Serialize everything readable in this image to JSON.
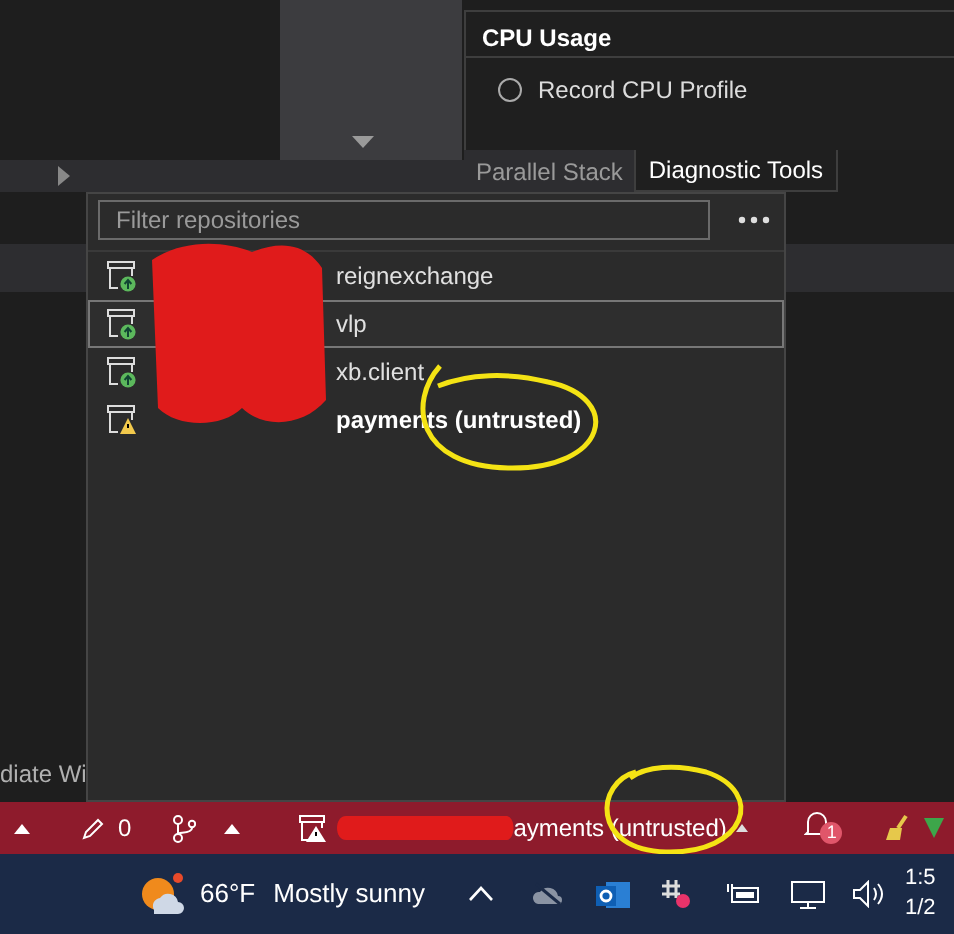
{
  "cpu_panel": {
    "title": "CPU Usage",
    "record_option": {
      "label": "Record CPU Profile",
      "checked": false
    }
  },
  "tabs": [
    {
      "label": "Parallel Stack",
      "selected": false
    },
    {
      "label": "Diagnostic Tools",
      "selected": true
    }
  ],
  "repo_picker": {
    "filter": {
      "placeholder": "Filter repositories"
    },
    "repositories": [
      {
        "name": "reignexchange",
        "kind": "synced",
        "selected": false,
        "bold": false
      },
      {
        "name": "vlp",
        "kind": "synced",
        "selected": true,
        "bold": false
      },
      {
        "name": "xb.client",
        "kind": "synced",
        "selected": false,
        "bold": false
      },
      {
        "name": "payments (untrusted)",
        "kind": "warning",
        "selected": false,
        "bold": true
      }
    ]
  },
  "background_window": {
    "label": "diate Wi"
  },
  "status_bar": {
    "pending_changes": "0",
    "repository": "ayments (untrusted)",
    "notifications": "1"
  },
  "taskbar": {
    "temperature": "66°F",
    "weather": "Mostly sunny",
    "time": "1:5",
    "date": "1/2"
  }
}
